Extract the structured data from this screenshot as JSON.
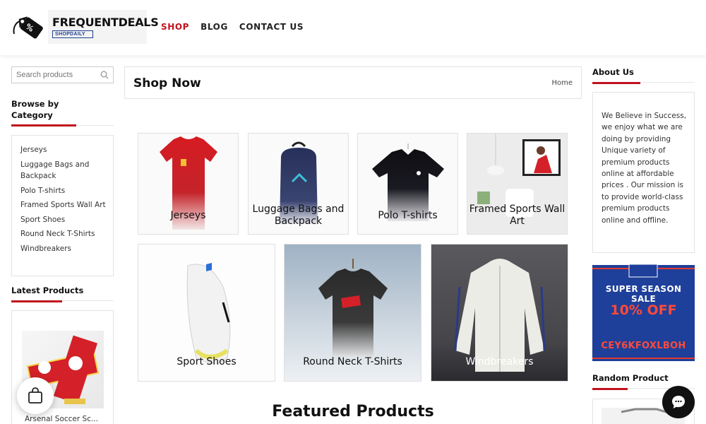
{
  "header": {
    "logo_title": "FREQUENTDEALS",
    "logo_sub": "SHOPDAILY",
    "logo_tag_text": "%",
    "nav": [
      {
        "label": "SHOP",
        "active": true
      },
      {
        "label": "BLOG",
        "active": false
      },
      {
        "label": "CONTACT US",
        "active": false
      }
    ]
  },
  "left_sidebar": {
    "search_placeholder": "Search products",
    "browse_title": "Browse by Category",
    "categories": [
      "Jerseys",
      "Luggage Bags and Backpack",
      "Polo T-shirts",
      "Framed Sports Wall Art",
      "Sport Shoes",
      "Round Neck T-Shirts",
      "Windbreakers"
    ],
    "latest_title": "Latest Products",
    "latest_product": "Arsenal Soccer Sc..."
  },
  "main": {
    "title": "Shop Now",
    "breadcrumb": "Home",
    "tiles_row1": [
      "Jerseys",
      "Luggage Bags and Backpack",
      "Polo T-shirts",
      "Framed Sports Wall Art"
    ],
    "tiles_row2": [
      "Sport Shoes",
      "Round Neck T-Shirts",
      "Windbreakers"
    ],
    "featured_title": "Featured Products"
  },
  "right_sidebar": {
    "about_title": "About Us",
    "about_text": "We Believe in Success, we enjoy what we are doing by providing Unique variety of premium products online at affordable prices . Our mission is to provide world-class premium products online and offline.",
    "promo_line1": "SUPER SEASON SALE",
    "promo_line2": "10% OFF",
    "promo_line3": "CEY6KFOXLBOH",
    "random_title": "Random Product"
  },
  "colors": {
    "accent_red": "#c0121e",
    "promo_blue": "#1e3f9a",
    "promo_red": "#ff4a3a"
  }
}
